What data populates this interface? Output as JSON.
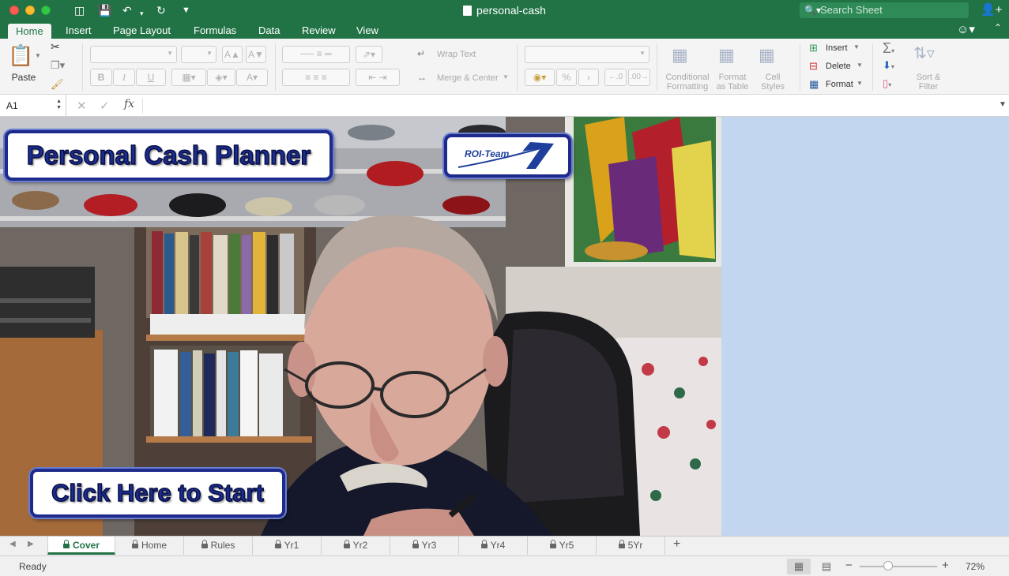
{
  "window": {
    "title": "personal-cash",
    "search_placeholder": "Search Sheet"
  },
  "ribbon_tabs": [
    "Home",
    "Insert",
    "Page Layout",
    "Formulas",
    "Data",
    "Review",
    "View"
  ],
  "active_ribbon_tab": "Home",
  "ribbon": {
    "paste": "Paste",
    "wrap_text": "Wrap Text",
    "merge_center": "Merge & Center",
    "bold": "B",
    "italic": "I",
    "underline": "U",
    "percent": "%",
    "conditional_formatting": [
      "Conditional",
      "Formatting"
    ],
    "format_as_table": [
      "Format",
      "as Table"
    ],
    "cell_styles": [
      "Cell",
      "Styles"
    ],
    "insert": "Insert",
    "delete": "Delete",
    "format": "Format",
    "sort_filter": [
      "Sort &",
      "Filter"
    ]
  },
  "formula_bar": {
    "name_box": "A1",
    "fx": "fx",
    "value": ""
  },
  "sheet": {
    "title_callout": "Personal Cash Planner",
    "start_button": "Click Here to Start",
    "logo_text": "ROI-Team"
  },
  "sheet_tabs": [
    "Cover",
    "Home",
    "Rules",
    "Yr1",
    "Yr2",
    "Yr3",
    "Yr4",
    "Yr5",
    "5Yr"
  ],
  "active_sheet_tab": "Cover",
  "status_bar": {
    "status": "Ready",
    "zoom": "72%",
    "zoom_level": 0.72
  },
  "colors": {
    "excel_green": "#217346",
    "sheet_background": "#c2d7ef",
    "callout_border": "#1e2a8c"
  }
}
